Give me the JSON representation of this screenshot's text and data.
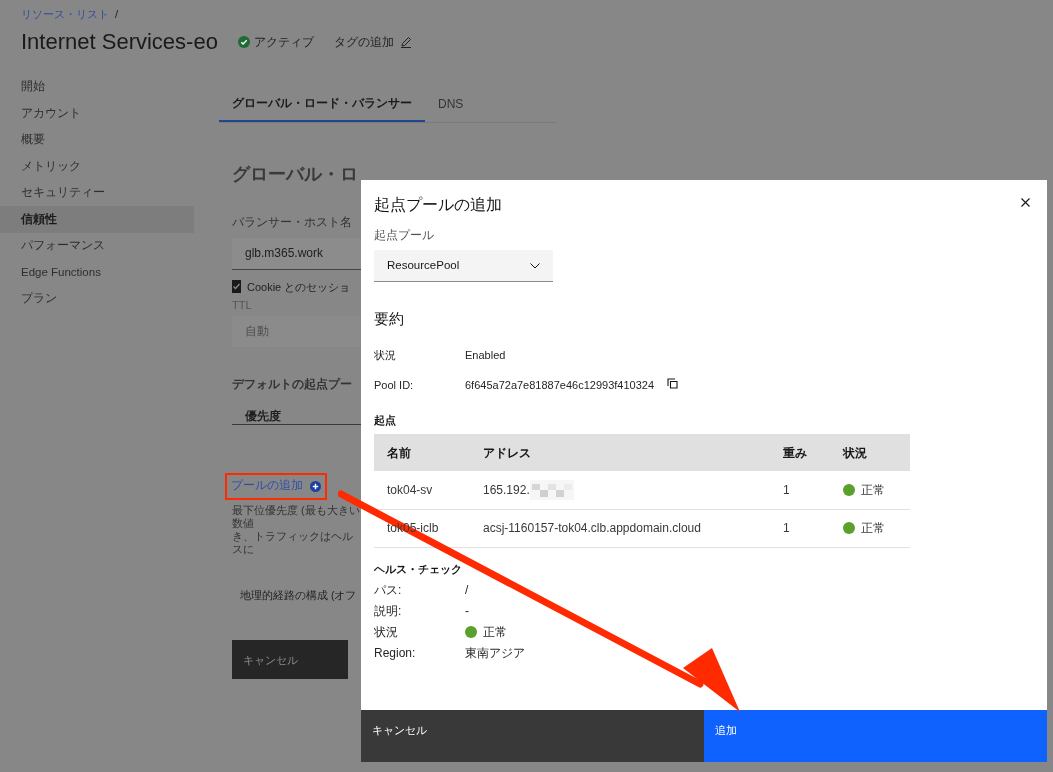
{
  "breadcrumb": {
    "link": "リソース・リスト",
    "separator": "/"
  },
  "header": {
    "title": "Internet Services-eo",
    "status": "アクティブ",
    "add_tag": "タグの追加"
  },
  "sidebar": {
    "items": [
      {
        "label": "開始",
        "selected": false
      },
      {
        "label": "アカウント",
        "selected": false
      },
      {
        "label": "概要",
        "selected": false
      },
      {
        "label": "メトリック",
        "selected": false
      },
      {
        "label": "セキュリティー",
        "selected": false
      },
      {
        "label": "信頼性",
        "selected": true
      },
      {
        "label": "パフォーマンス",
        "selected": false
      },
      {
        "label": "Edge Functions",
        "selected": false
      },
      {
        "label": "プラン",
        "selected": false
      }
    ]
  },
  "tabs": [
    {
      "label": "グローバル・ロード・バランサー",
      "selected": true
    },
    {
      "label": "DNS",
      "selected": false
    }
  ],
  "form": {
    "heading": "グローバル・ロ",
    "host_label": "バランサー・ホスト名",
    "host_value": "glb.m365.work",
    "cookie": {
      "label": "Cookie とのセッショ",
      "checked": true
    },
    "ttl_label": "TTL",
    "ttl_value": "自動",
    "pool_heading": "デフォルトの起点プー",
    "priority_column": "優先度",
    "add_pool": "プールの追加",
    "help_lines": [
      "最下位優先度 (最も大きい数値",
      "き、トラフィックはヘルスに"
    ],
    "geo": "地理的経路の構成 (オフ",
    "cancel": "キャンセル"
  },
  "modal": {
    "title": "起点プールの追加",
    "pool_label": "起点プール",
    "pool_value": "ResourcePool",
    "summary_heading": "要約",
    "summary": [
      {
        "label": "状況",
        "value": "Enabled",
        "kind": "text"
      },
      {
        "label": "Pool ID:",
        "value": "6f645a72a7e81887e46c12993f410324",
        "kind": "copy"
      }
    ],
    "origins_heading": "起点",
    "columns": [
      "名前",
      "アドレス",
      "重み",
      "状況"
    ],
    "rows": [
      {
        "name": "tok04-sv",
        "address": "165.192.",
        "blurred": true,
        "weight": "1",
        "status": "正常",
        "color": "#5aa02c"
      },
      {
        "name": "tok05-iclb",
        "address": "acsj-1160157-tok04.clb.appdomain.cloud",
        "blurred": false,
        "weight": "1",
        "status": "正常",
        "color": "#5aa02c"
      }
    ],
    "health_heading": "ヘルス・チェック",
    "health": [
      {
        "label": "パス:",
        "value": "/",
        "kind": "text"
      },
      {
        "label": "説明:",
        "value": "-",
        "kind": "text"
      },
      {
        "label": "状況",
        "value": "正常",
        "kind": "status",
        "color": "#5aa02c"
      },
      {
        "label": "Region:",
        "value": "東南アジア",
        "kind": "text"
      }
    ],
    "cancel": "キャンセル",
    "submit": "追加"
  }
}
